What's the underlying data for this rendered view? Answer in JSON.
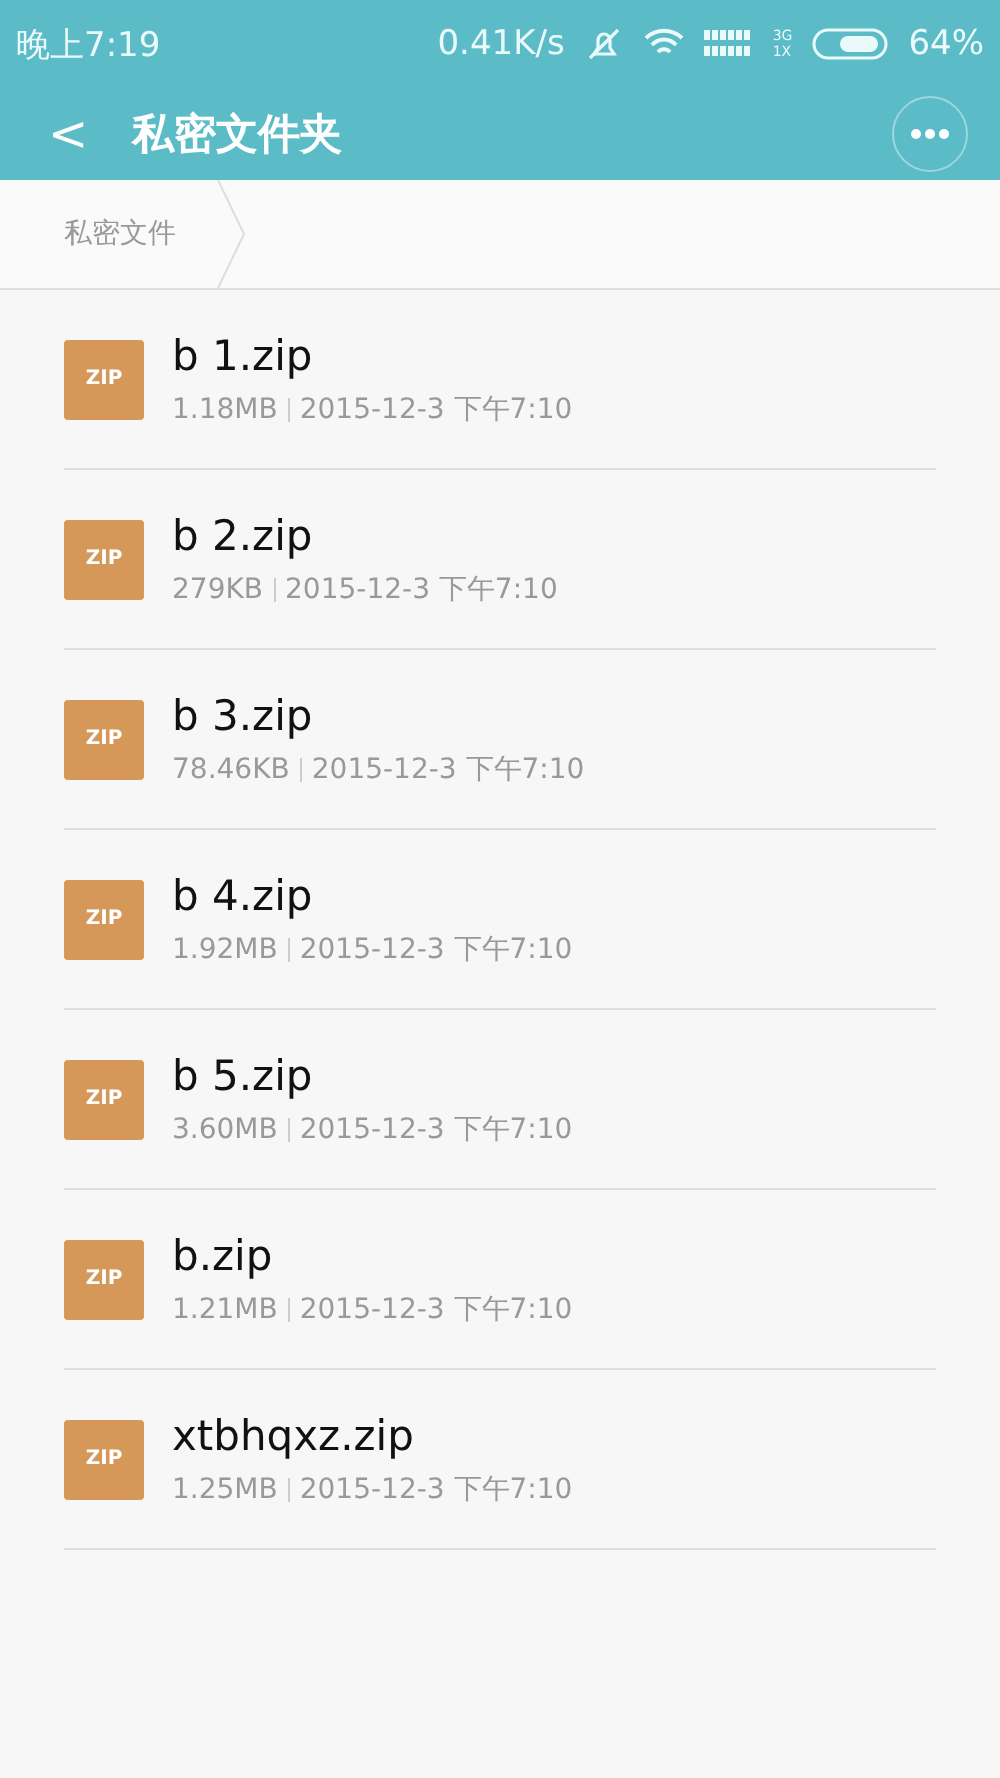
{
  "status_bar": {
    "time": "晚上7:19",
    "speed": "0.41K/s",
    "network_top": "3G",
    "network_bottom": "1X",
    "battery_text": "64%"
  },
  "header": {
    "back": "<",
    "title": "私密文件夹"
  },
  "breadcrumb": [
    "私密文件"
  ],
  "files": [
    {
      "type_label": "ZIP",
      "name": "b 1.zip",
      "size": "1.18MB",
      "date": "2015-12-3 下午7:10"
    },
    {
      "type_label": "ZIP",
      "name": "b 2.zip",
      "size": "279KB",
      "date": "2015-12-3 下午7:10"
    },
    {
      "type_label": "ZIP",
      "name": "b 3.zip",
      "size": "78.46KB",
      "date": "2015-12-3 下午7:10"
    },
    {
      "type_label": "ZIP",
      "name": "b 4.zip",
      "size": "1.92MB",
      "date": "2015-12-3 下午7:10"
    },
    {
      "type_label": "ZIP",
      "name": "b 5.zip",
      "size": "3.60MB",
      "date": "2015-12-3 下午7:10"
    },
    {
      "type_label": "ZIP",
      "name": "b.zip",
      "size": "1.21MB",
      "date": "2015-12-3 下午7:10"
    },
    {
      "type_label": "ZIP",
      "name": "xtbhqxz.zip",
      "size": "1.25MB",
      "date": "2015-12-3 下午7:10"
    }
  ]
}
